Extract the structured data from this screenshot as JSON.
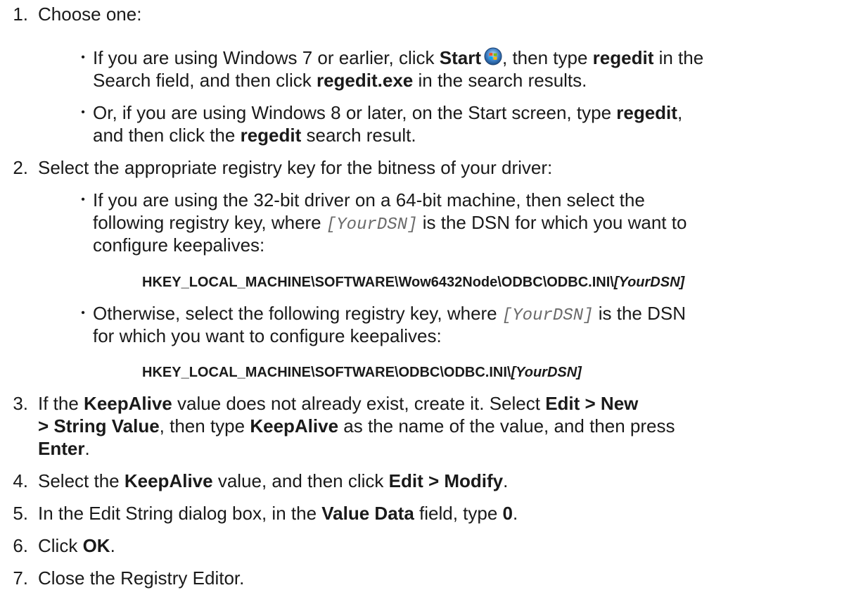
{
  "steps": [
    {
      "num": "1."
    },
    {
      "num": "2."
    },
    {
      "num": "3."
    },
    {
      "num": "4."
    },
    {
      "num": "5."
    },
    {
      "num": "6."
    },
    {
      "num": "7."
    }
  ],
  "bullet": "•",
  "s1": {
    "intro": "Choose one:",
    "b1": {
      "l1a": "If you are using Windows 7 or earlier, click ",
      "start": "Start",
      "l1b": ", then type ",
      "regedit": "regedit",
      "l1c": " in the",
      "l2a": "Search field, and then click ",
      "regedit_exe": "regedit.exe",
      "l2b": " in the search results."
    },
    "b2": {
      "l1a": "Or, if you are using Windows 8 or later, on the Start screen, type ",
      "regedit": "regedit",
      "l1b": ",",
      "l2a": "and then click the ",
      "regedit2": "regedit",
      "l2b": " search result."
    }
  },
  "s2": {
    "intro": "Select the appropriate registry key for the bitness of your driver:",
    "b1": {
      "l1": "If you are using the 32-bit driver on a 64-bit machine, then select the",
      "l2a": "following registry key, where ",
      "dsn": "[YourDSN]",
      "l2b": " is the DSN for which you want to",
      "l3": "configure keepalives:",
      "key": "HKEY_LOCAL_MACHINE\\SOFTWARE\\Wow6432Node\\ODBC\\ODBC.INI\\",
      "key_dsn": "[YourDSN]"
    },
    "b2": {
      "l1a": "Otherwise, select the following registry key, where ",
      "dsn": "[YourDSN]",
      "l1b": " is the DSN",
      "l2": "for which you want to configure keepalives:",
      "key": "HKEY_LOCAL_MACHINE\\SOFTWARE\\ODBC\\ODBC.INI\\",
      "key_dsn": "[YourDSN]"
    }
  },
  "s3": {
    "l1a": "If the ",
    "keepalive": "KeepAlive",
    "l1b": " value does not already exist, create it. Select ",
    "edit_new": "Edit > New",
    "l2_string": "> String Value",
    "l2a": ", then type ",
    "keepalive2": "KeepAlive",
    "l2b": " as the name of the value, and then press",
    "enter": "Enter",
    "l3b": "."
  },
  "s4": {
    "a": "Select the ",
    "keepalive": "KeepAlive",
    "b": " value, and then click ",
    "edit_modify": "Edit > Modify",
    "c": "."
  },
  "s5": {
    "a": "In the Edit String dialog box, in the ",
    "value_data": "Value Data",
    "b": " field, type ",
    "zero": "0",
    "c": "."
  },
  "s6": {
    "a": "Click ",
    "ok": "OK",
    "b": "."
  },
  "s7": {
    "text": "Close the Registry Editor."
  },
  "icons": {
    "start": "windows-start-orb-icon"
  }
}
